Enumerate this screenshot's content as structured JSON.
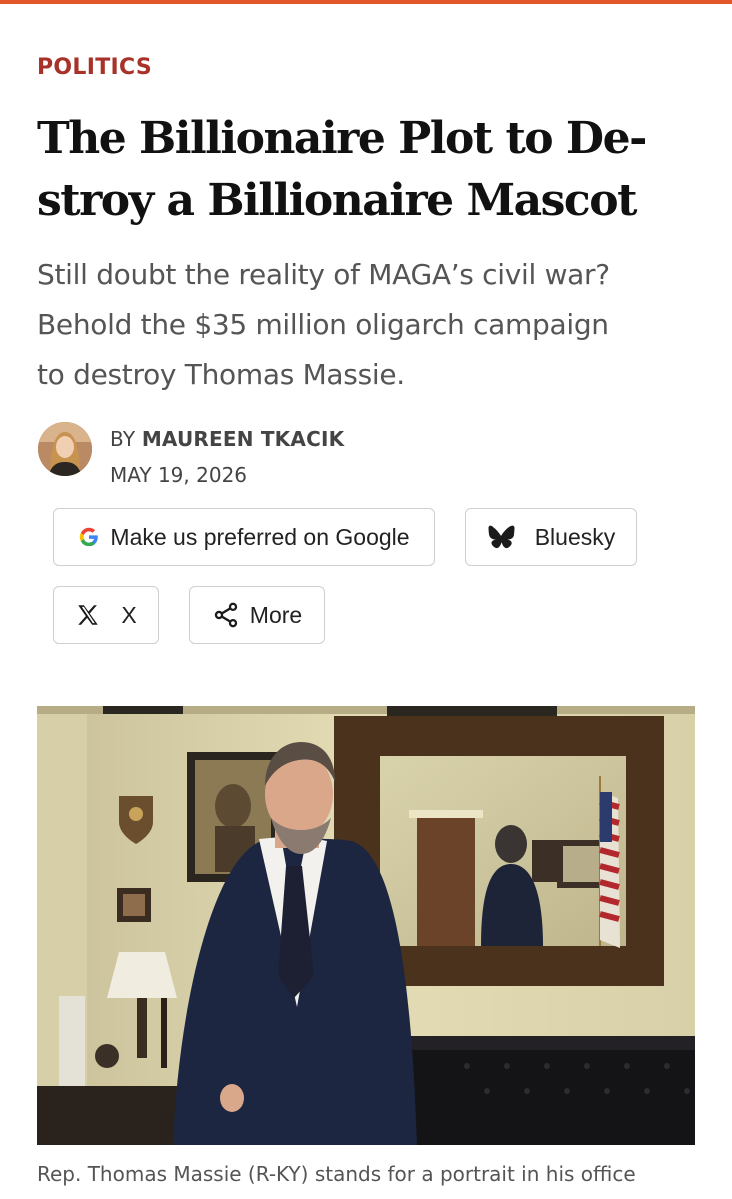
{
  "article": {
    "section": "POLITICS",
    "title_lines": [
      "The Billionaire Plot to De-",
      "stroy a Billionaire Mascot"
    ],
    "dek_lines": [
      "Still doubt the reality of MAGA’s civil war?",
      "Behold the $35 million oligarch campaign",
      "to destroy Thomas Massie."
    ],
    "byline_prefix": "BY ",
    "author": "MAUREEN TKACIK",
    "date": "MAY 19, 2026",
    "caption": "Rep. Thomas Massie (R-KY) stands for a portrait in his office"
  },
  "share": {
    "google": "Make us preferred on Google",
    "bluesky": "Bluesky",
    "x": "X",
    "more": "More"
  },
  "colors": {
    "accent": "#e2582a",
    "section": "#a8322a"
  },
  "icons": [
    "google-g-icon",
    "bluesky-butterfly-icon",
    "x-logo-icon",
    "share-icon"
  ]
}
